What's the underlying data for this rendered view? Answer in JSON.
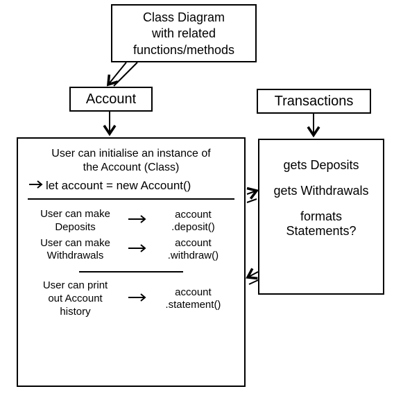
{
  "title": {
    "line1": "Class Diagram",
    "line2": "with related",
    "line3": "functions/methods"
  },
  "classes": {
    "account": {
      "label": "Account",
      "init": {
        "desc_a": "User can initialise an instance of",
        "desc_b": "the Account (Class)",
        "code": "let account = new Account()"
      },
      "methods": [
        {
          "desc_a": "User can make",
          "desc_b": "Deposits",
          "code_a": "account",
          "code_b": ".deposit()"
        },
        {
          "desc_a": "User can make",
          "desc_b": "Withdrawals",
          "code_a": "account",
          "code_b": ".withdraw()"
        },
        {
          "desc_a": "User can print",
          "desc_b": "out Account",
          "desc_c": "history",
          "code_a": "account",
          "code_b": ".statement()"
        }
      ]
    },
    "transactions": {
      "label": "Transactions",
      "lines": {
        "l1": "gets Deposits",
        "l2": "gets Withdrawals",
        "l3": "formats",
        "l4": "Statements?"
      }
    }
  }
}
